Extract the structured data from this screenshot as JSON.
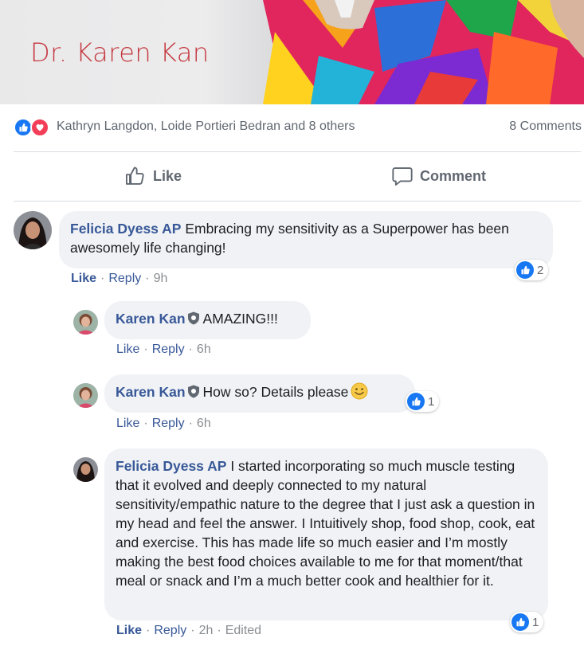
{
  "banner": {
    "title": "Dr. Karen Kan"
  },
  "reactions": {
    "names": "Kathryn Langdon, Loide Portieri Bedran and 8 others",
    "comments_count": "8 Comments",
    "like_color": "#1877f2",
    "love_color": "#f33e58"
  },
  "actions": {
    "like": "Like",
    "comment": "Comment"
  },
  "comments": [
    {
      "author": "Felicia Dyess AP",
      "text": "Embracing my sensitivity as a Superpower has been awesomely life changing!",
      "like": "Like",
      "reply": "Reply",
      "time": "9h",
      "reaction_count": "2"
    },
    {
      "author": "Karen Kan",
      "text": "AMAZING!!!",
      "like": "Like",
      "reply": "Reply",
      "time": "6h"
    },
    {
      "author": "Karen Kan",
      "text": "How so? Details please",
      "like": "Like",
      "reply": "Reply",
      "time": "6h",
      "reaction_count": "1"
    },
    {
      "author": "Felicia Dyess AP",
      "text": "I started incorporating so much muscle testing that it evolved and deeply connected to my natural sensitivity/empathic nature to the degree that I just ask a question in my head and feel the answer. I Intuitively shop, food shop, cook, eat and exercise. This has made life so much easier and I’m mostly making the best food choices available to me for that moment/that meal or snack and I’m a much better cook and healthier for it.",
      "like": "Like",
      "reply": "Reply",
      "time": "2h",
      "edited": "Edited",
      "reaction_count": "1"
    }
  ]
}
